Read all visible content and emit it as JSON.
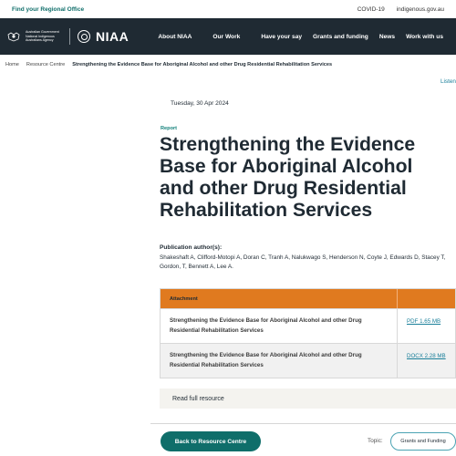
{
  "topbar": {
    "office_link": "Find your Regional Office",
    "links": [
      "COVID-19",
      "indigenous.gov.au"
    ]
  },
  "nav": {
    "gov_text": "Australian Government National Indigenous Australians Agency",
    "brand": "NIAA",
    "menu": [
      "About NIAA",
      "Our Work",
      "Have your say",
      "Grants and funding",
      "News",
      "Work with us"
    ]
  },
  "breadcrumb": {
    "home": "Home",
    "section": "Resource Centre",
    "current": "Strengthening the Evidence Base for Aboriginal Alcohol and other Drug Residential Rehabilitation Services"
  },
  "listen": "Listen",
  "article": {
    "date": "Tuesday, 30 Apr 2024",
    "type": "Report",
    "title": "Strengthening the Evidence Base for Aboriginal Alcohol and other Drug Residential Rehabilitation Services",
    "authors_label": "Publication author(s):",
    "authors": "Shakeshaft A, Clifford-Motopi A, Doran C, Tranh A, Nalukwago S, Henderson N, Coyte J, Edwards D, Stacey T, Gordon, T, Bennett A, Lee A."
  },
  "attachments": {
    "header": "Attachment",
    "rows": [
      {
        "name": "Strengthening the Evidence Base for Aboriginal Alcohol and other Drug Residential Rehabilitation Services",
        "file": "PDF 1.65 MB"
      },
      {
        "name": "Strengthening the Evidence Base for Aboriginal Alcohol and other Drug Residential Rehabilitation Services",
        "file": "DOCX 2.28 MB"
      }
    ]
  },
  "read_full": "Read full resource",
  "footer": {
    "back_button": "Back to Resource Centre",
    "topic_label": "Topic:",
    "topic": "Grants and Funding"
  },
  "colors": {
    "nav_bg": "#1f2a33",
    "accent_teal": "#0f6e6a",
    "attachment_header": "#e07a1f",
    "link": "#1a7f9a"
  }
}
